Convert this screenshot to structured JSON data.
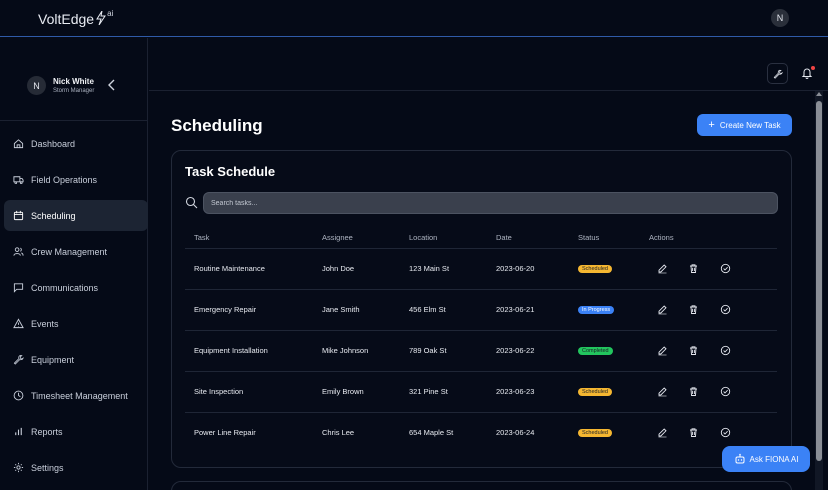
{
  "brand": {
    "name": "VoltEdge",
    "suffix": "ai"
  },
  "top_avatar": "N",
  "user": {
    "initial": "N",
    "name": "Nick White",
    "role": "Storm Manager"
  },
  "nav": [
    {
      "label": "Dashboard",
      "icon": "home-icon"
    },
    {
      "label": "Field Operations",
      "icon": "truck-icon"
    },
    {
      "label": "Scheduling",
      "icon": "calendar-icon",
      "active": true
    },
    {
      "label": "Crew Management",
      "icon": "users-icon"
    },
    {
      "label": "Communications",
      "icon": "message-icon"
    },
    {
      "label": "Events",
      "icon": "alert-triangle-icon"
    },
    {
      "label": "Equipment",
      "icon": "wrench-icon"
    },
    {
      "label": "Timesheet Management",
      "icon": "clock-icon"
    },
    {
      "label": "Reports",
      "icon": "bar-chart-icon"
    },
    {
      "label": "Settings",
      "icon": "gear-icon"
    }
  ],
  "page": {
    "title": "Scheduling",
    "create_label": "Create New Task"
  },
  "card": {
    "title": "Task Schedule",
    "search_placeholder": "Search tasks...",
    "columns": [
      "Task",
      "Assignee",
      "Location",
      "Date",
      "Status",
      "Actions"
    ],
    "rows": [
      {
        "task": "Routine Maintenance",
        "assignee": "John Doe",
        "location": "123 Main St",
        "date": "2023-06-20",
        "status": "Scheduled"
      },
      {
        "task": "Emergency Repair",
        "assignee": "Jane Smith",
        "location": "456 Elm St",
        "date": "2023-06-21",
        "status": "In Progress"
      },
      {
        "task": "Equipment Installation",
        "assignee": "Mike Johnson",
        "location": "789 Oak St",
        "date": "2023-06-22",
        "status": "Completed"
      },
      {
        "task": "Site Inspection",
        "assignee": "Emily Brown",
        "location": "321 Pine St",
        "date": "2023-06-23",
        "status": "Scheduled"
      },
      {
        "task": "Power Line Repair",
        "assignee": "Chris Lee",
        "location": "654 Maple St",
        "date": "2023-06-24",
        "status": "Scheduled"
      }
    ]
  },
  "status_colors": {
    "Scheduled": "#f5b731",
    "In Progress": "#3b82f6",
    "Completed": "#22c55e"
  },
  "fiona": {
    "label": "Ask FIONA AI",
    "icon": "bot-icon"
  },
  "colors": {
    "accent": "#3b82f6",
    "background": "#050a17"
  }
}
